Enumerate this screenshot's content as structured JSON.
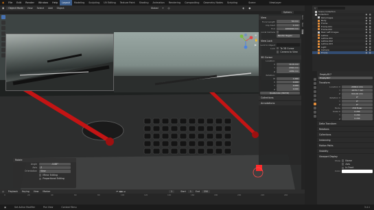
{
  "menubar": {
    "menus": [
      "File",
      "Edit",
      "Render",
      "Window",
      "Help"
    ],
    "workspaces": [
      "Layout",
      "Modeling",
      "Sculpting",
      "UV Editing",
      "Texture Paint",
      "Shading",
      "Animation",
      "Rendering",
      "Compositing",
      "Geometry Nodes",
      "Scripting"
    ],
    "active_workspace": "Layout",
    "scene_label": "Scene",
    "viewlayer_label": "ViewLayer"
  },
  "viewport_header": {
    "mode": "Object Mode",
    "menus": [
      "View",
      "Select",
      "Add",
      "Object"
    ],
    "transform": "Global",
    "options": "Options"
  },
  "npanel": {
    "view_section": "View",
    "focal_length_label": "Focal Length",
    "focal_length": "50 mm",
    "clip_start_label": "Clip Start",
    "clip_start": "1 mm",
    "clip_end_label": "End",
    "clip_end": "1000000 mm",
    "local_camera_label": "Local Camera",
    "render_region": "Render Region",
    "view_lock_section": "View Lock",
    "lock_object_label": "Lock to Object",
    "lock_label": "Lock",
    "to_3d_cursor": "To 3D Cursor",
    "camera_to_view": "Camera to View",
    "cursor_section": "3D Cursor",
    "location_label": "Location:",
    "cursor_x_label": "X",
    "cursor_x": "1116 mm",
    "cursor_y_label": "Y",
    "cursor_y": "4360 mm",
    "cursor_z_label": "Z",
    "cursor_z": "1089 mm",
    "rotation_label": "Rotation:",
    "rot_w_label": "W",
    "rot_w": "1.000",
    "rot_x_label": "X",
    "rot_x": "0.000",
    "rot_y_label": "Y",
    "rot_y": "0.000",
    "rot_z_label": "Z",
    "rot_z": "0.000",
    "rotation_mode": "Quaternion (WXYZ)",
    "collections_section": "Collections",
    "annotations_section": "Annotations",
    "tabs": [
      "Item",
      "Tool",
      "View"
    ]
  },
  "operator_panel": {
    "title": "Rotate",
    "angle_label": "Angle",
    "angle": "-5.88°",
    "axis_label": "Axis",
    "axis": "Z",
    "orientation_label": "Orientation",
    "orientation": "View",
    "proportional_label": "Proportional Editing",
    "mirror_label": "Mirror Editing"
  },
  "timeline": {
    "menus": [
      "Playback",
      "Keying",
      "View",
      "Marker"
    ],
    "start_label": "Start",
    "start": "1",
    "end_label": "End",
    "end": "250",
    "current_frame": "1",
    "ruler": [
      "0",
      "20",
      "40",
      "60",
      "80",
      "100",
      "120",
      "140",
      "160",
      "180",
      "200",
      "220",
      "240"
    ]
  },
  "statusbar": {
    "select": "Set Active Modifier",
    "pan": "Pan View",
    "context": "Context Menu",
    "version": "3.4.1"
  },
  "outliner": {
    "title": "Scene Collection",
    "rows": [
      {
        "name": "Collection",
        "type": "collection"
      },
      {
        "name": "Ref_Images",
        "type": "collection"
      },
      {
        "name": "Body",
        "type": "object"
      },
      {
        "name": "Frame",
        "type": "object"
      },
      {
        "name": "Frame.001",
        "type": "object"
      },
      {
        "name": "Frame.002",
        "type": "object"
      },
      {
        "name": "Rear Left Images",
        "type": "collection"
      },
      {
        "name": "Lattice",
        "type": "object"
      },
      {
        "name": "Lattice.001",
        "type": "object"
      },
      {
        "name": "Lattice.002",
        "type": "object"
      },
      {
        "name": "Lattice.003",
        "type": "object"
      },
      {
        "name": "Light",
        "type": "object"
      },
      {
        "name": "Camera",
        "type": "object"
      },
      {
        "name": "Empty",
        "type": "object"
      }
    ]
  },
  "properties": {
    "object_name": "Empty.B17",
    "object_field": "Empty.B17",
    "transform_section": "Transform",
    "location_label": "Location X",
    "loc_x": "2090.2 mm",
    "loc_y_label": "Y",
    "loc_y": "-1675.7 mm",
    "loc_z_label": "Z",
    "loc_z": "944.02 mm",
    "rotation_label": "Rotation X",
    "rot_x": "0°",
    "rot_y_label": "Y",
    "rot_y": "0°",
    "rot_z_label": "Z",
    "rot_z": "0°",
    "mode_label": "Mode",
    "mode": "XYZ Euler",
    "scale_label": "Scale X",
    "scale_x": "0.294",
    "scale_y_label": "Y",
    "scale_y": "0.294",
    "scale_z_label": "Z",
    "scale_z": "0.294",
    "sections": [
      "Delta Transform",
      "Relations",
      "Collections",
      "Instancing",
      "Motion Paths",
      "Visibility",
      "Viewport Display"
    ],
    "show_label": "Show",
    "show_name": "Name",
    "show_axis": "Axis",
    "in_front": "In Front",
    "color_label": "Color"
  },
  "colors": {
    "accent": "#4772b3",
    "object_orange": "#e38e3b",
    "wiper_red": "#c41414"
  }
}
